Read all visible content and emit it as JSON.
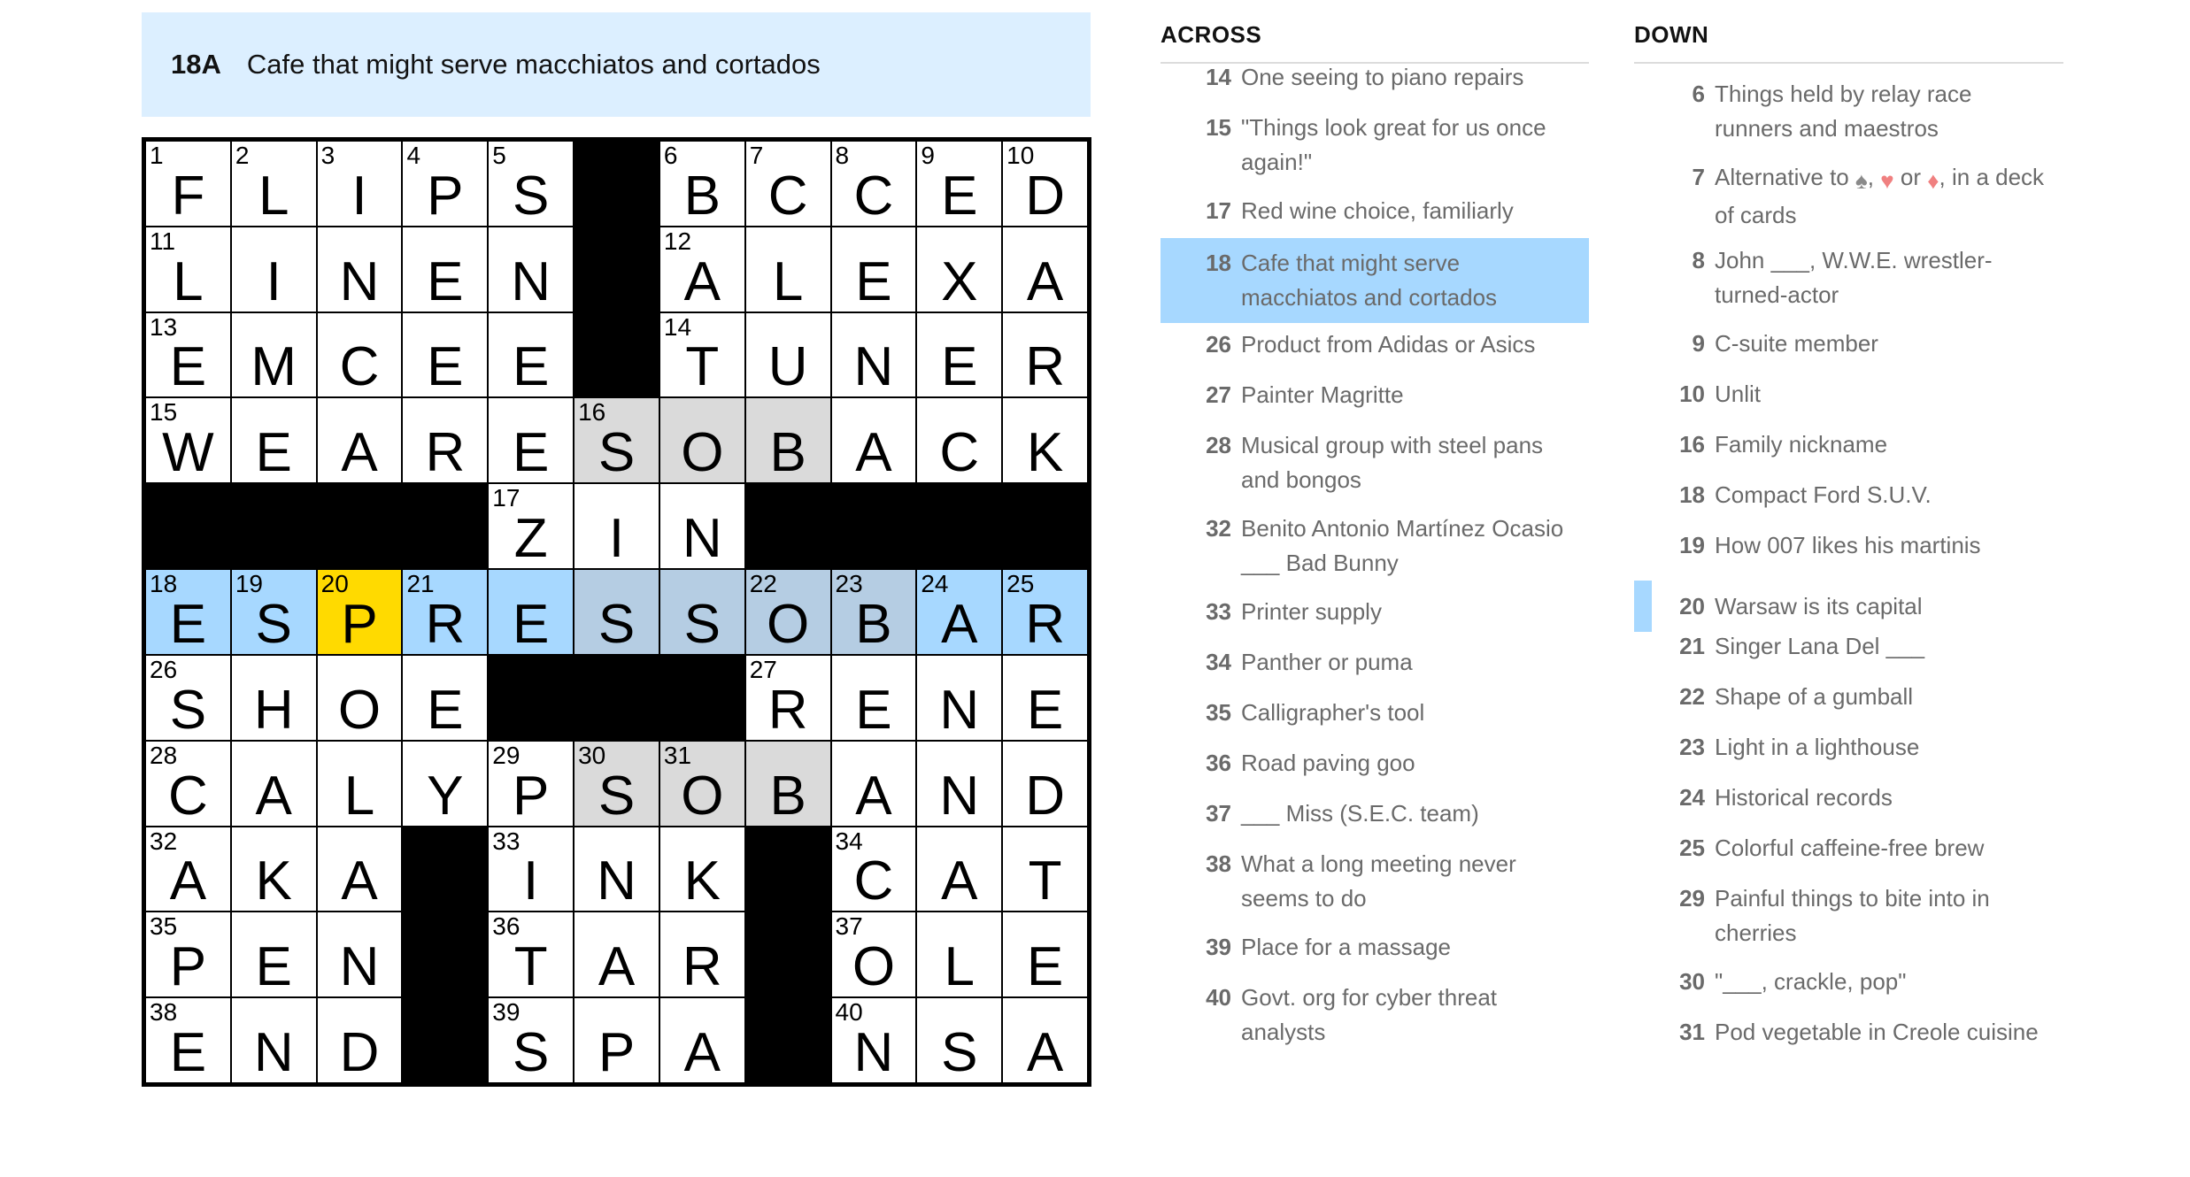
{
  "clue_bar": {
    "number": "18A",
    "text": "Cafe that might serve macchiatos and cortados"
  },
  "grid": {
    "rows": [
      [
        {
          "n": "1",
          "l": "F"
        },
        {
          "n": "2",
          "l": "L"
        },
        {
          "n": "3",
          "l": "I"
        },
        {
          "n": "4",
          "l": "P"
        },
        {
          "n": "5",
          "l": "S"
        },
        {
          "b": true
        },
        {
          "n": "6",
          "l": "B"
        },
        {
          "n": "7",
          "l": "C"
        },
        {
          "n": "8",
          "l": "C"
        },
        {
          "n": "9",
          "l": "E"
        },
        {
          "n": "10",
          "l": "D"
        }
      ],
      [
        {
          "n": "11",
          "l": "L"
        },
        {
          "l": "I"
        },
        {
          "l": "N"
        },
        {
          "l": "E"
        },
        {
          "l": "N"
        },
        {
          "b": true
        },
        {
          "n": "12",
          "l": "A"
        },
        {
          "l": "L"
        },
        {
          "l": "E"
        },
        {
          "l": "X"
        },
        {
          "l": "A"
        }
      ],
      [
        {
          "n": "13",
          "l": "E"
        },
        {
          "l": "M"
        },
        {
          "l": "C"
        },
        {
          "l": "E"
        },
        {
          "l": "E"
        },
        {
          "b": true
        },
        {
          "n": "14",
          "l": "T"
        },
        {
          "l": "U"
        },
        {
          "l": "N"
        },
        {
          "l": "E"
        },
        {
          "l": "R"
        }
      ],
      [
        {
          "n": "15",
          "l": "W"
        },
        {
          "l": "E"
        },
        {
          "l": "A"
        },
        {
          "l": "R"
        },
        {
          "l": "E"
        },
        {
          "n": "16",
          "l": "S",
          "s": "circled"
        },
        {
          "l": "O",
          "s": "circled"
        },
        {
          "l": "B",
          "s": "circled"
        },
        {
          "l": "A"
        },
        {
          "l": "C"
        },
        {
          "l": "K"
        }
      ],
      [
        {
          "b": true
        },
        {
          "b": true
        },
        {
          "b": true
        },
        {
          "b": true
        },
        {
          "n": "17",
          "l": "Z"
        },
        {
          "l": "I"
        },
        {
          "l": "N"
        },
        {
          "b": true
        },
        {
          "b": true
        },
        {
          "b": true
        },
        {
          "b": true
        }
      ],
      [
        {
          "n": "18",
          "l": "E",
          "s": "word"
        },
        {
          "n": "19",
          "l": "S",
          "s": "word"
        },
        {
          "n": "20",
          "l": "P",
          "s": "active"
        },
        {
          "n": "21",
          "l": "R",
          "s": "word"
        },
        {
          "l": "E",
          "s": "word"
        },
        {
          "l": "S",
          "s": "wordcircled"
        },
        {
          "l": "S",
          "s": "wordcircled"
        },
        {
          "n": "22",
          "l": "O",
          "s": "wordcircled"
        },
        {
          "n": "23",
          "l": "B",
          "s": "wordcircled"
        },
        {
          "n": "24",
          "l": "A",
          "s": "word"
        },
        {
          "n": "25",
          "l": "R",
          "s": "word"
        }
      ],
      [
        {
          "n": "26",
          "l": "S"
        },
        {
          "l": "H"
        },
        {
          "l": "O"
        },
        {
          "l": "E"
        },
        {
          "b": true
        },
        {
          "b": true
        },
        {
          "b": true
        },
        {
          "n": "27",
          "l": "R"
        },
        {
          "l": "E"
        },
        {
          "l": "N"
        },
        {
          "l": "E"
        }
      ],
      [
        {
          "n": "28",
          "l": "C"
        },
        {
          "l": "A"
        },
        {
          "l": "L"
        },
        {
          "l": "Y"
        },
        {
          "n": "29",
          "l": "P"
        },
        {
          "n": "30",
          "l": "S",
          "s": "circled"
        },
        {
          "n": "31",
          "l": "O",
          "s": "circled"
        },
        {
          "l": "B",
          "s": "circled"
        },
        {
          "l": "A"
        },
        {
          "l": "N"
        },
        {
          "l": "D"
        }
      ],
      [
        {
          "n": "32",
          "l": "A"
        },
        {
          "l": "K"
        },
        {
          "l": "A"
        },
        {
          "b": true
        },
        {
          "n": "33",
          "l": "I"
        },
        {
          "l": "N"
        },
        {
          "l": "K"
        },
        {
          "b": true
        },
        {
          "n": "34",
          "l": "C"
        },
        {
          "l": "A"
        },
        {
          "l": "T"
        }
      ],
      [
        {
          "n": "35",
          "l": "P"
        },
        {
          "l": "E"
        },
        {
          "l": "N"
        },
        {
          "b": true
        },
        {
          "n": "36",
          "l": "T"
        },
        {
          "l": "A"
        },
        {
          "l": "R"
        },
        {
          "b": true
        },
        {
          "n": "37",
          "l": "O"
        },
        {
          "l": "L"
        },
        {
          "l": "E"
        }
      ],
      [
        {
          "n": "38",
          "l": "E"
        },
        {
          "l": "N"
        },
        {
          "l": "D"
        },
        {
          "b": true
        },
        {
          "n": "39",
          "l": "S"
        },
        {
          "l": "P"
        },
        {
          "l": "A"
        },
        {
          "b": true
        },
        {
          "n": "40",
          "l": "N"
        },
        {
          "l": "S"
        },
        {
          "l": "A"
        }
      ]
    ]
  },
  "across": {
    "heading": "ACROSS",
    "clues": [
      {
        "num": "14",
        "text": "One seeing to piano repairs"
      },
      {
        "num": "15",
        "text": "\"Things look great for us once again!\""
      },
      {
        "num": "17",
        "text": "Red wine choice, familiarly"
      },
      {
        "num": "18",
        "text": "Cafe that might serve macchiatos and cortados",
        "state": "sel"
      },
      {
        "num": "26",
        "text": "Product from Adidas or Asics"
      },
      {
        "num": "27",
        "text": "Painter Magritte"
      },
      {
        "num": "28",
        "text": "Musical group with steel pans and bongos"
      },
      {
        "num": "32",
        "text": "Benito Antonio Martínez Ocasio ___ Bad Bunny"
      },
      {
        "num": "33",
        "text": "Printer supply"
      },
      {
        "num": "34",
        "text": "Panther or puma"
      },
      {
        "num": "35",
        "text": "Calligrapher's tool"
      },
      {
        "num": "36",
        "text": "Road paving goo"
      },
      {
        "num": "37",
        "text": "___ Miss (S.E.C. team)"
      },
      {
        "num": "38",
        "text": "What a long meeting never seems to do"
      },
      {
        "num": "39",
        "text": "Place for a massage"
      },
      {
        "num": "40",
        "text": "Govt. org for cyber threat analysts"
      }
    ]
  },
  "down": {
    "heading": "DOWN",
    "clues": [
      {
        "num": "6",
        "text": "Things held by relay race runners and maestros"
      },
      {
        "num": "7",
        "text": "Alternative to ♠, ♥ or ♦, in a deck of cards"
      },
      {
        "num": "8",
        "text": "John ___, W.W.E. wrestler-turned-actor"
      },
      {
        "num": "9",
        "text": "C-suite member"
      },
      {
        "num": "10",
        "text": "Unlit"
      },
      {
        "num": "16",
        "text": "Family nickname"
      },
      {
        "num": "18",
        "text": "Compact Ford S.U.V."
      },
      {
        "num": "19",
        "text": "How 007 likes his martinis"
      },
      {
        "num": "20",
        "text": "Warsaw is its capital",
        "state": "cross"
      },
      {
        "num": "21",
        "text": "Singer Lana Del ___"
      },
      {
        "num": "22",
        "text": "Shape of a gumball"
      },
      {
        "num": "23",
        "text": "Light in a lighthouse"
      },
      {
        "num": "24",
        "text": "Historical records"
      },
      {
        "num": "25",
        "text": "Colorful caffeine-free brew"
      },
      {
        "num": "29",
        "text": "Painful things to bite into in cherries"
      },
      {
        "num": "30",
        "text": "\"___, crackle, pop\""
      },
      {
        "num": "31",
        "text": "Pod vegetable in Creole cuisine"
      }
    ]
  },
  "colors": {
    "suit_spade": "#8a8a8a",
    "suit_red": "#f08080",
    "highlight": "#a7d8ff",
    "active": "#ffda00",
    "circled": "#dadada"
  }
}
